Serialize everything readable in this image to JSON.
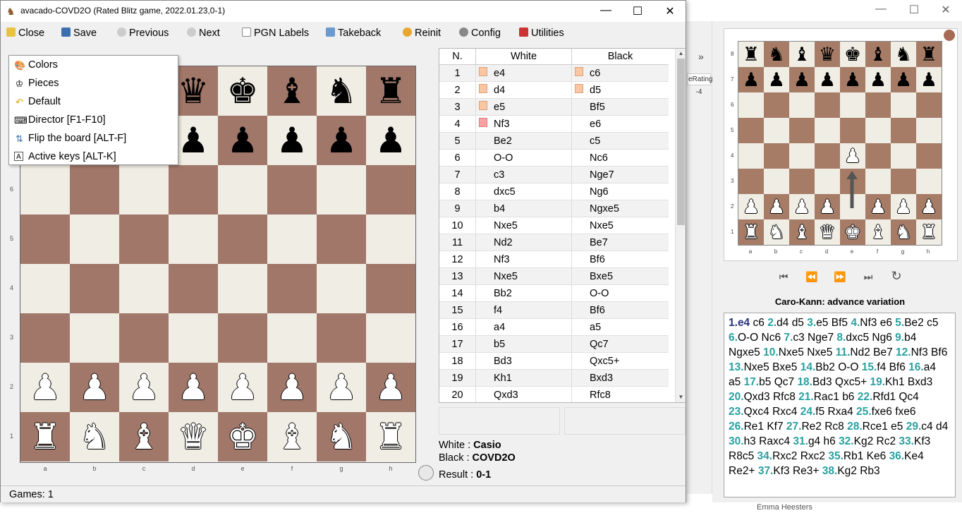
{
  "window": {
    "title": "avacado-COVD2O (Rated Blitz game, 2022.01.23,0-1)",
    "controls": [
      "—",
      "☐",
      "✕"
    ]
  },
  "toolbar": {
    "close": "Close",
    "save": "Save",
    "previous": "Previous",
    "next": "Next",
    "pgn_labels": "PGN Labels",
    "takeback": "Takeback",
    "reinit": "Reinit",
    "config": "Config",
    "utilities": "Utilities"
  },
  "context_menu": {
    "items": [
      "Colors",
      "Pieces",
      "Default",
      "Director [F1-F10]",
      "Flip the board [ALT-F]",
      "Active keys [ALT-K]"
    ]
  },
  "board": {
    "files": [
      "a",
      "b",
      "c",
      "d",
      "e",
      "f",
      "g",
      "h"
    ],
    "ranks": [
      "1",
      "2",
      "3",
      "4",
      "5",
      "6"
    ]
  },
  "moves_table": {
    "headers": [
      "N.",
      "White",
      "Black"
    ],
    "rows": [
      {
        "n": "1",
        "white": "e4",
        "black": "c6"
      },
      {
        "n": "2",
        "white": "d4",
        "black": "d5"
      },
      {
        "n": "3",
        "white": "e5",
        "black": "Bf5"
      },
      {
        "n": "4",
        "white": "Nf3",
        "black": "e6"
      },
      {
        "n": "5",
        "white": "Be2",
        "black": "c5"
      },
      {
        "n": "6",
        "white": "O-O",
        "black": "Nc6"
      },
      {
        "n": "7",
        "white": "c3",
        "black": "Nge7"
      },
      {
        "n": "8",
        "white": "dxc5",
        "black": "Ng6"
      },
      {
        "n": "9",
        "white": "b4",
        "black": "Ngxe5"
      },
      {
        "n": "10",
        "white": "Nxe5",
        "black": "Nxe5"
      },
      {
        "n": "11",
        "white": "Nd2",
        "black": "Be7"
      },
      {
        "n": "12",
        "white": "Nf3",
        "black": "Bf6"
      },
      {
        "n": "13",
        "white": "Nxe5",
        "black": "Bxe5"
      },
      {
        "n": "14",
        "white": "Bb2",
        "black": "O-O"
      },
      {
        "n": "15",
        "white": "f4",
        "black": "Bf6"
      },
      {
        "n": "16",
        "white": "a4",
        "black": "a5"
      },
      {
        "n": "17",
        "white": "b5",
        "black": "Qc7"
      },
      {
        "n": "18",
        "white": "Bd3",
        "black": "Qxc5+"
      },
      {
        "n": "19",
        "white": "Kh1",
        "black": "Bxd3"
      },
      {
        "n": "20",
        "white": "Qxd3",
        "black": "Rfc8"
      }
    ]
  },
  "game_info": {
    "white_label": "White :",
    "white_name": "Casio",
    "black_label": "Black :",
    "black_name": "COVD2O",
    "result_label": "Result :",
    "result": "0-1"
  },
  "status": {
    "games": "Games: 1"
  },
  "right_panel": {
    "rating_label": "eRating",
    "rating_value": "-4",
    "collapse": "»",
    "opening": "Caro-Kann: advance variation",
    "mini_files": [
      "a",
      "b",
      "c",
      "d",
      "e",
      "f",
      "g",
      "h"
    ],
    "mini_ranks": [
      "8",
      "7",
      "6",
      "5",
      "4",
      "3",
      "2",
      "1"
    ],
    "nav_icons": [
      "first-icon",
      "prev-icon",
      "next-icon",
      "last-icon",
      "reload-icon"
    ],
    "movetext": [
      [
        "1.",
        "e4",
        "c6"
      ],
      [
        "2.",
        "d4",
        "d5"
      ],
      [
        "3.",
        "e5",
        "Bf5"
      ],
      [
        "4.",
        "Nf3",
        "e6"
      ],
      [
        "5.",
        "Be2",
        "c5"
      ],
      [
        "6.",
        "O-O",
        "Nc6"
      ],
      [
        "7.",
        "c3",
        "Nge7"
      ],
      [
        "8.",
        "dxc5",
        "Ng6"
      ],
      [
        "9.",
        "b4",
        "Ngxe5"
      ],
      [
        "10.",
        "Nxe5",
        "Nxe5"
      ],
      [
        "11.",
        "Nd2",
        "Be7"
      ],
      [
        "12.",
        "Nf3",
        "Bf6"
      ],
      [
        "13.",
        "Nxe5",
        "Bxe5"
      ],
      [
        "14.",
        "Bb2",
        "O-O"
      ],
      [
        "15.",
        "f4",
        "Bf6"
      ],
      [
        "16.",
        "a4",
        "a5"
      ],
      [
        "17.",
        "b5",
        "Qc7"
      ],
      [
        "18.",
        "Bd3",
        "Qxc5+"
      ],
      [
        "19.",
        "Kh1",
        "Bxd3"
      ],
      [
        "20.",
        "Qxd3",
        "Rfc8"
      ],
      [
        "21.",
        "Rac1",
        "b6"
      ],
      [
        "22.",
        "Rfd1",
        "Qc4"
      ],
      [
        "23.",
        "Qxc4",
        "Rxc4"
      ],
      [
        "24.",
        "f5",
        "Rxa4"
      ],
      [
        "25.",
        "fxe6",
        "fxe6"
      ],
      [
        "26.",
        "Re1",
        "Kf7"
      ],
      [
        "27.",
        "Re2",
        "Rc8"
      ],
      [
        "28.",
        "Rce1",
        "e5"
      ],
      [
        "29.",
        "c4",
        "d4"
      ],
      [
        "30.",
        "h3",
        "Raxc4"
      ],
      [
        "31.",
        "g4",
        "h6"
      ],
      [
        "32.",
        "Kg2",
        "Rc2"
      ],
      [
        "33.",
        "Kf3",
        "R8c5"
      ],
      [
        "34.",
        "Rxc2",
        "Rxc2"
      ],
      [
        "35.",
        "Rb1",
        "Ke6"
      ],
      [
        "36.",
        "Ke4",
        "Re2+"
      ],
      [
        "37.",
        "Kf3",
        "Re3+"
      ],
      [
        "38.",
        "Kg2",
        "Rb3"
      ]
    ],
    "footer_name": "Emma Heesters"
  },
  "colors": {
    "light_square": "#f0ede4",
    "dark_square": "#a1776a",
    "move_number": "#2aa0a0",
    "current_move_number": "#27327a"
  }
}
